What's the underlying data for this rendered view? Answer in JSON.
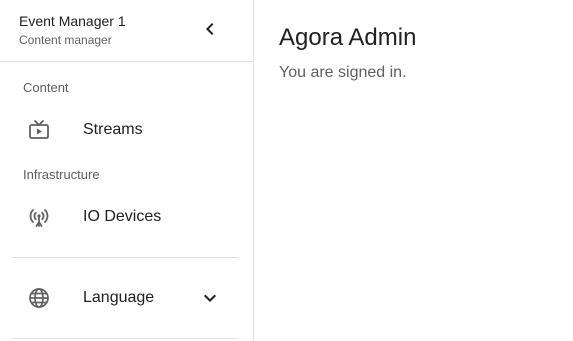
{
  "sidebar": {
    "user": {
      "name": "Event Manager 1",
      "role": "Content manager"
    },
    "sections": [
      {
        "label": "Content",
        "items": [
          {
            "label": "Streams",
            "icon": "tv-play-icon"
          }
        ]
      },
      {
        "label": "Infrastructure",
        "items": [
          {
            "label": "IO Devices",
            "icon": "antenna-icon"
          }
        ]
      }
    ],
    "language": {
      "label": "Language",
      "icon": "globe-icon"
    }
  },
  "main": {
    "title": "Agora Admin",
    "subtitle": "You are signed in."
  },
  "colors": {
    "text_primary": "#212121",
    "text_secondary": "#616161",
    "icon": "#616161",
    "divider": "#e0e0e0"
  }
}
